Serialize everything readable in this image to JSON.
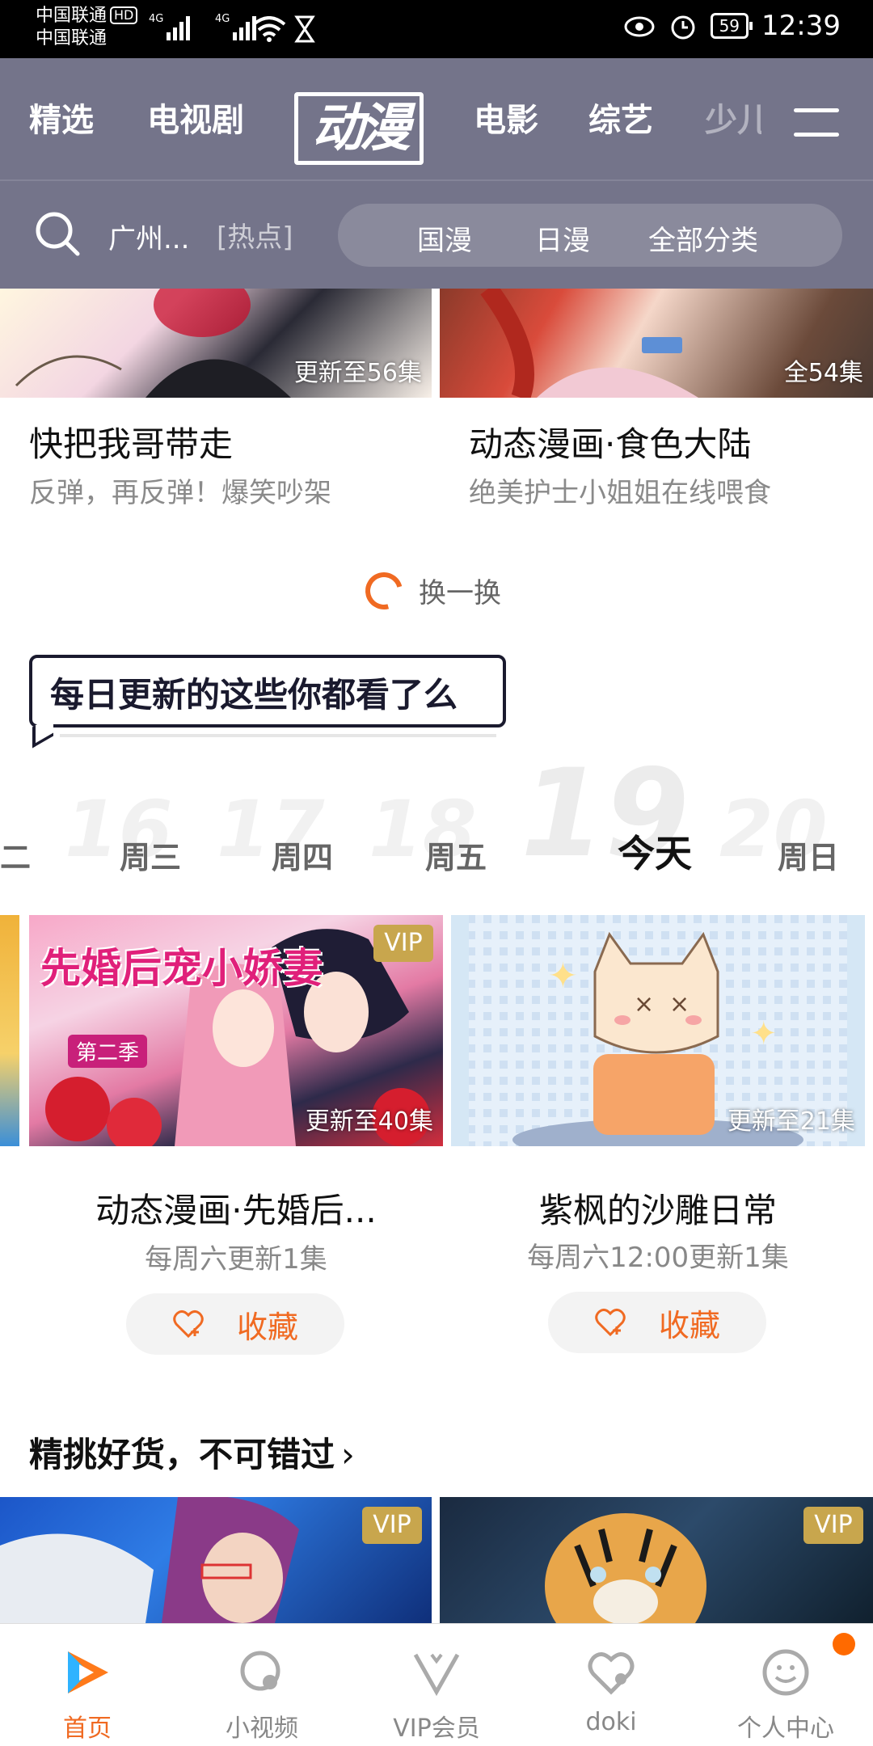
{
  "status_bar": {
    "carrier1": "中国联通",
    "carrier2": "中国联通",
    "hd": "HD",
    "net1": "4G",
    "net2": "4G",
    "battery": "59",
    "time": "12:39"
  },
  "header": {
    "tabs": [
      "精选",
      "电视剧",
      "动漫",
      "电影",
      "综艺",
      "少儿"
    ],
    "search_text": "广州...",
    "search_tag": "[热点]",
    "categories": [
      "国漫",
      "日漫",
      "全部分类"
    ],
    "colors": {
      "bg": "#74748a",
      "accent": "#f06a22"
    }
  },
  "top_cards": [
    {
      "title": "快把我哥带走",
      "subtitle": "反弹，再反弹！爆笑吵架",
      "badge": "更新至56集"
    },
    {
      "title": "动态漫画·食色大陆",
      "subtitle": "绝美护士小姐姐在线喂食",
      "badge": "全54集"
    }
  ],
  "refresh_label": "换一换",
  "daily_banner": "每日更新的这些你都看了么",
  "week": {
    "numbers": [
      "16",
      "17",
      "18",
      "19",
      "20"
    ],
    "days": [
      "二",
      "周三",
      "周四",
      "周五",
      "今天",
      "周日"
    ]
  },
  "daily_cards": [
    {
      "title": "动态漫画·先婚后...",
      "subtitle": "每周六更新1集",
      "badge": "更新至40集",
      "vip": "VIP",
      "poster_text": "先婚后宠小娇妻",
      "poster_sub": "第二季",
      "fav": "收藏"
    },
    {
      "title": "紫枫的沙雕日常",
      "subtitle": "每周六12:00更新1集",
      "badge": "更新至21集",
      "fav": "收藏"
    }
  ],
  "section": {
    "title": "精挑好货，不可错过"
  },
  "bottom_cards": [
    {
      "vip": "VIP"
    },
    {
      "vip": "VIP"
    }
  ],
  "bottom_nav": [
    "首页",
    "小视频",
    "VIP会员",
    "doki",
    "个人中心"
  ]
}
